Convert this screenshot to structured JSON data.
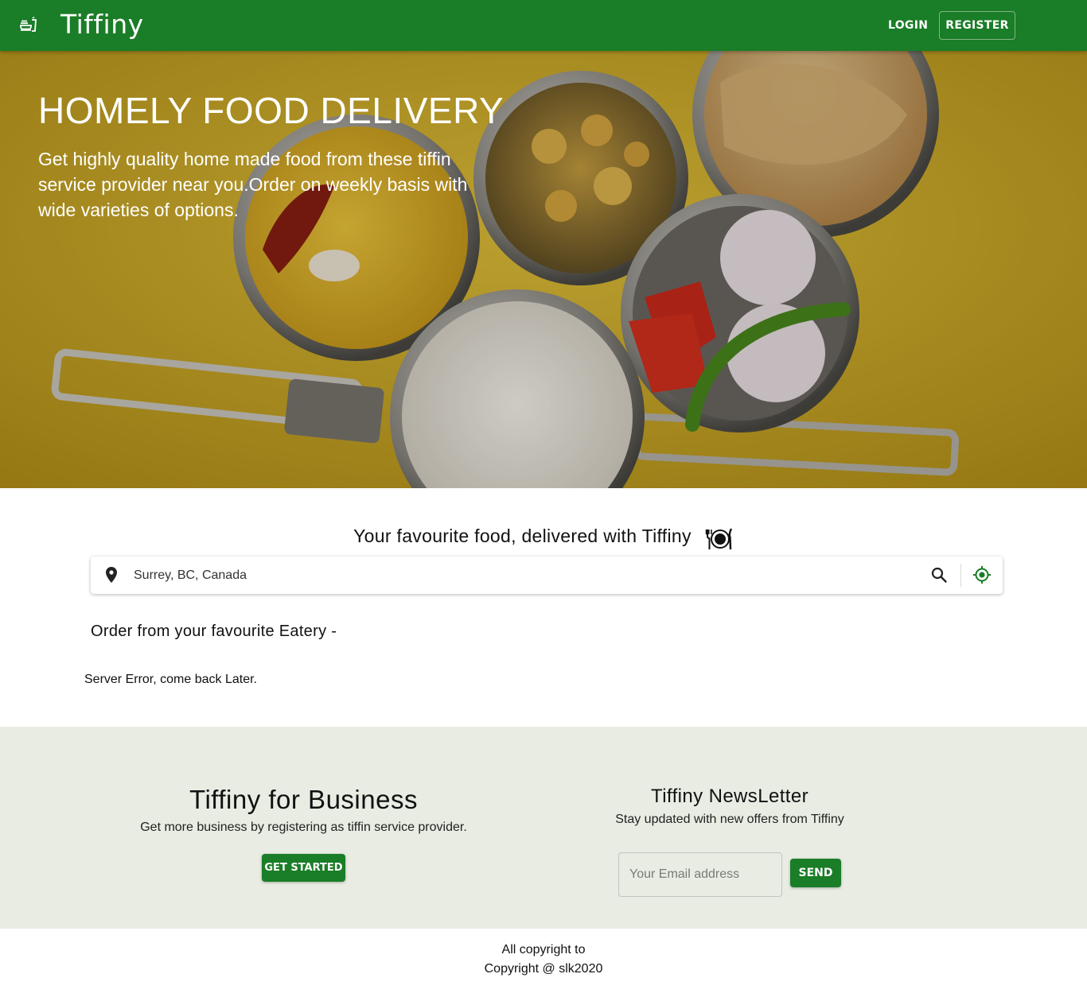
{
  "header": {
    "brand": "Tiffiny",
    "brand_icon": "food-bowl-icon",
    "login_label": "LOGIN",
    "register_label": "REGISTER",
    "bar_color": "#1a7d27"
  },
  "hero": {
    "title": "HOMELY FOOD DELIVERY",
    "subtitle": "Get highly quality home made food from these tiffin service provider near you.Order on weekly basis with wide varieties of options."
  },
  "search": {
    "tagline": "Your favourite food, delivered with Tiffiny",
    "tagline_icon": "plate-cutlery-icon",
    "location_value": "Surrey, BC, Canada",
    "location_icon": "map-pin-icon",
    "search_icon": "search-icon",
    "gps_icon": "my-location-icon",
    "accent": "#1a7d27"
  },
  "eateries": {
    "heading": "Order from your favourite Eatery -",
    "status_message": "Server Error, come back Later."
  },
  "business": {
    "title": "Tiffiny for Business",
    "subtitle": "Get more business by registering as tiffin service provider.",
    "button_label": "GET STARTED"
  },
  "newsletter": {
    "title": "Tiffiny NewsLetter",
    "subtitle": "Stay updated with new offers from Tiffiny",
    "email_placeholder": "Your Email address",
    "button_label": "SEND",
    "band_color": "#e8ece2"
  },
  "footer": {
    "line1": "All copyright to",
    "line2": "Copyright @ slk2020"
  }
}
